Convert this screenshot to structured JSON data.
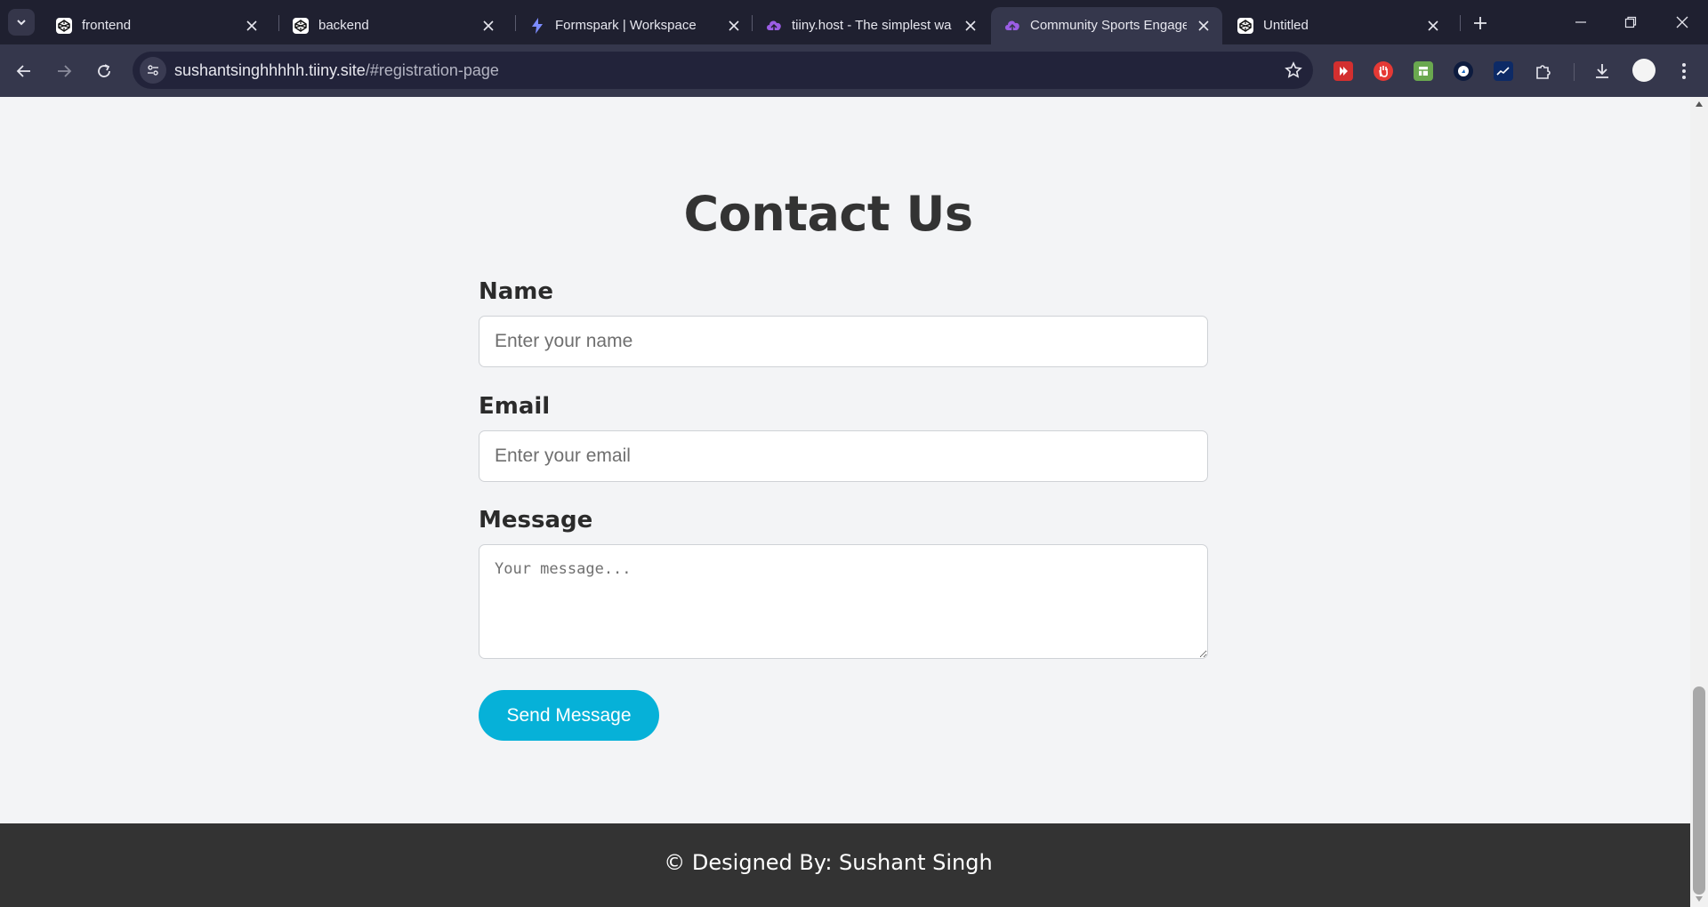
{
  "browser": {
    "tabs": [
      {
        "title": "frontend",
        "favicon": "codepen-icon"
      },
      {
        "title": "backend",
        "favicon": "codepen-icon"
      },
      {
        "title": "Formspark | Workspace",
        "favicon": "bolt-icon"
      },
      {
        "title": "tiiny.host - The simplest wa",
        "favicon": "cloud-upload-icon"
      },
      {
        "title": "Community Sports Engage",
        "favicon": "cloud-upload-icon",
        "active": true
      },
      {
        "title": "Untitled",
        "favicon": "codepen-icon"
      }
    ],
    "url_host": "sushantsinghhhhh.tiiny.site",
    "url_path": "/#registration-page",
    "extensions": [
      "red-play-extension",
      "red-hand-extension",
      "green-sheet-extension",
      "blue-circle-extension",
      "chart-extension",
      "puzzle-icon"
    ],
    "accent": "#35374c"
  },
  "page": {
    "heading": "Contact Us",
    "form": {
      "name_label": "Name",
      "name_placeholder": "Enter your name",
      "email_label": "Email",
      "email_placeholder": "Enter your email",
      "message_label": "Message",
      "message_placeholder": "Your message...",
      "submit_label": "Send Message"
    },
    "footer": "© Designed By: Sushant Singh",
    "colors": {
      "button": "#06b1d8",
      "footer": "#333333",
      "background": "#f3f4f6"
    }
  }
}
